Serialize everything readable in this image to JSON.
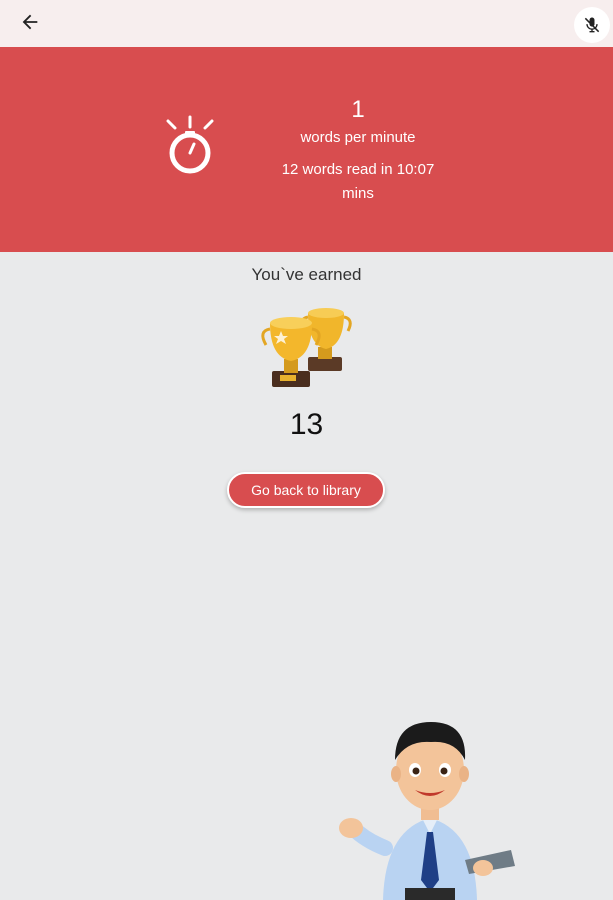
{
  "header": {
    "back_icon": "arrow-left-icon",
    "mic_icon": "microphone-off-icon"
  },
  "results": {
    "wpm_value": "1",
    "wpm_label": "words per minute",
    "read_summary_line1": "12 words read in 10:07",
    "read_summary_line2": "mins",
    "timer_icon": "stopwatch-icon"
  },
  "reward": {
    "earned_label": "You`ve earned",
    "trophy_icon": "trophies-icon",
    "score": "13"
  },
  "actions": {
    "library_button_label": "Go back to library"
  },
  "colors": {
    "accent": "#d84d4f",
    "background": "#e9eaeb",
    "topbar": "#f7eeee"
  }
}
